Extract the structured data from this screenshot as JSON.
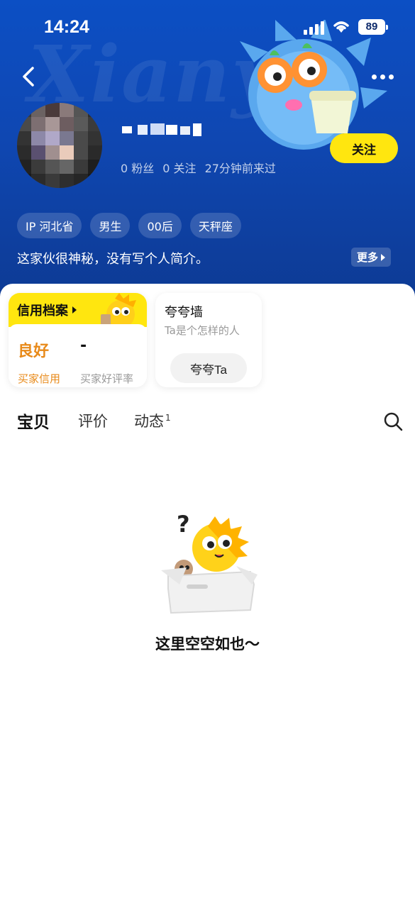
{
  "status_bar": {
    "time": "14:24",
    "battery": "89"
  },
  "header": {
    "watermark": "Xianyu",
    "stats": {
      "fans": "0 粉丝",
      "following": "0 关注",
      "last_visit": "27分钟前来过"
    },
    "follow_label": "关注",
    "tags": [
      "IP 河北省",
      "男生",
      "00后",
      "天秤座"
    ],
    "bio": "这家伙很神秘，没有写个人简介。",
    "bio_more": "更多"
  },
  "credit_card": {
    "title": "信用档案",
    "credit_value": "良好",
    "credit_label": "买家信用",
    "rate_value": "-",
    "rate_label": "买家好评率"
  },
  "praise_card": {
    "title": "夸夸墙",
    "subtitle": "Ta是个怎样的人",
    "button": "夸夸Ta"
  },
  "tabs": [
    {
      "label": "宝贝"
    },
    {
      "label": "评价"
    },
    {
      "label": "动态",
      "badge": "1"
    }
  ],
  "empty_state": {
    "text": "这里空空如也～"
  },
  "colors": {
    "header_blue": "#0f47b2",
    "accent_yellow": "#ffe60f",
    "credit_orange": "#e88a1a"
  }
}
